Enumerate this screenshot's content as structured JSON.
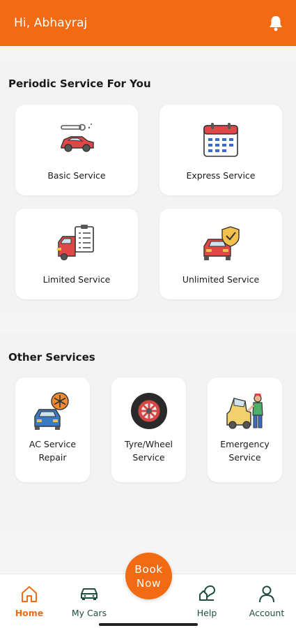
{
  "header": {
    "greeting": "Hi, Abhayraj",
    "icon": "bell-icon",
    "color": "#f26a12"
  },
  "periodic": {
    "title": "Periodic Service For You",
    "items": [
      {
        "label": "Basic Service",
        "icon": "car-wrench-icon"
      },
      {
        "label": "Express Service",
        "icon": "calendar-icon"
      },
      {
        "label": "Limited Service",
        "icon": "truck-checklist-icon"
      },
      {
        "label": "Unlimited Service",
        "icon": "car-shield-icon"
      }
    ]
  },
  "other": {
    "title": "Other Services",
    "items": [
      {
        "line1": "AC Service",
        "line2": "Repair",
        "icon": "car-ac-icon"
      },
      {
        "line1": "Tyre/Wheel",
        "line2": "Service",
        "icon": "tyre-icon"
      },
      {
        "line1": "Emergency",
        "line2": "Service",
        "icon": "mechanic-icon"
      }
    ]
  },
  "book_button": {
    "line1": "Book",
    "line2": "Now"
  },
  "nav": {
    "home": "Home",
    "my_cars": "My Cars",
    "help": "Help",
    "account": "Account"
  }
}
